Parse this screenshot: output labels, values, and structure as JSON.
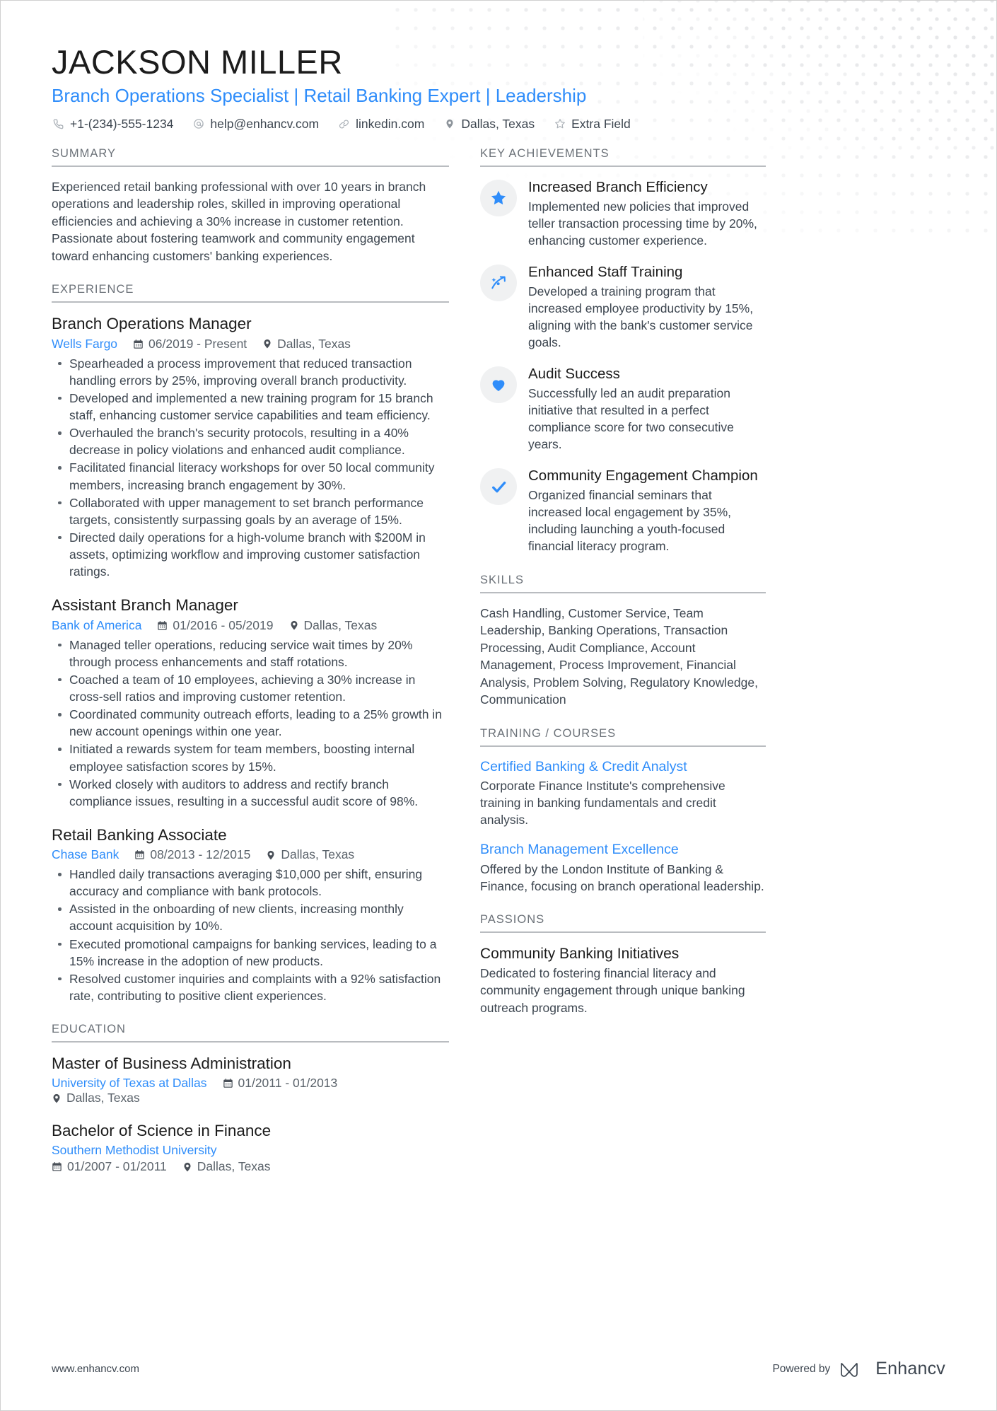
{
  "header": {
    "name": "JACKSON MILLER",
    "headline": "Branch Operations Specialist | Retail Banking Expert | Leadership",
    "contacts": [
      {
        "icon": "phone-icon",
        "text": "+1-(234)-555-1234"
      },
      {
        "icon": "email-icon",
        "text": "help@enhancv.com"
      },
      {
        "icon": "link-icon",
        "text": "linkedin.com"
      },
      {
        "icon": "location-icon",
        "text": "Dallas, Texas"
      },
      {
        "icon": "star-outline-icon",
        "text": "Extra Field"
      }
    ]
  },
  "summary": {
    "section_title": "SUMMARY",
    "text": "Experienced retail banking professional with over 10 years in branch operations and leadership roles, skilled in improving operational efficiencies and achieving a 30% increase in customer retention. Passionate about fostering teamwork and community engagement toward enhancing customers' banking experiences."
  },
  "experience": {
    "section_title": "EXPERIENCE",
    "entries": [
      {
        "title": "Branch Operations Manager",
        "org": "Wells Fargo",
        "dates": "06/2019 - Present",
        "location": "Dallas, Texas",
        "bullets": [
          "Spearheaded a process improvement that reduced transaction handling errors by 25%, improving overall branch productivity.",
          "Developed and implemented a new training program for 15 branch staff, enhancing customer service capabilities and team efficiency.",
          "Overhauled the branch's security protocols, resulting in a 40% decrease in policy violations and enhanced audit compliance.",
          "Facilitated financial literacy workshops for over 50 local community members, increasing branch engagement by 30%.",
          "Collaborated with upper management to set branch performance targets, consistently surpassing goals by an average of 15%.",
          "Directed daily operations for a high-volume branch with $200M in assets, optimizing workflow and improving customer satisfaction ratings."
        ]
      },
      {
        "title": "Assistant Branch Manager",
        "org": "Bank of America",
        "dates": "01/2016 - 05/2019",
        "location": "Dallas, Texas",
        "bullets": [
          "Managed teller operations, reducing service wait times by 20% through process enhancements and staff rotations.",
          "Coached a team of 10 employees, achieving a 30% increase in cross-sell ratios and improving customer retention.",
          "Coordinated community outreach efforts, leading to a 25% growth in new account openings within one year.",
          "Initiated a rewards system for team members, boosting internal employee satisfaction scores by 15%.",
          "Worked closely with auditors to address and rectify branch compliance issues, resulting in a successful audit score of 98%."
        ]
      },
      {
        "title": "Retail Banking Associate",
        "org": "Chase Bank",
        "dates": "08/2013 - 12/2015",
        "location": "Dallas, Texas",
        "bullets": [
          "Handled daily transactions averaging $10,000 per shift, ensuring accuracy and compliance with bank protocols.",
          "Assisted in the onboarding of new clients, increasing monthly account acquisition by 10%.",
          "Executed promotional campaigns for banking services, leading to a 15% increase in the adoption of new products.",
          "Resolved customer inquiries and complaints with a 92% satisfaction rate, contributing to positive client experiences."
        ]
      }
    ]
  },
  "education": {
    "section_title": "EDUCATION",
    "entries": [
      {
        "title": "Master of Business Administration",
        "org": "University of Texas at Dallas",
        "dates": "01/2011 - 01/2013",
        "location": "Dallas, Texas",
        "inline": true
      },
      {
        "title": "Bachelor of Science in Finance",
        "org": "Southern Methodist University",
        "dates": "01/2007 - 01/2011",
        "location": "Dallas, Texas",
        "inline": false
      }
    ]
  },
  "key_achievements": {
    "section_title": "KEY ACHIEVEMENTS",
    "items": [
      {
        "icon": "star-icon",
        "title": "Increased Branch Efficiency",
        "description": "Implemented new policies that improved teller transaction processing time by 20%, enhancing customer experience."
      },
      {
        "icon": "growth-arrow-icon",
        "title": "Enhanced Staff Training",
        "description": "Developed a training program that increased employee productivity by 15%, aligning with the bank's customer service goals."
      },
      {
        "icon": "heart-icon",
        "title": "Audit Success",
        "description": "Successfully led an audit preparation initiative that resulted in a perfect compliance score for two consecutive years."
      },
      {
        "icon": "check-icon",
        "title": "Community Engagement Champion",
        "description": "Organized financial seminars that increased local engagement by 35%, including launching a youth-focused financial literacy program."
      }
    ]
  },
  "skills": {
    "section_title": "SKILLS",
    "text": "Cash Handling, Customer Service, Team Leadership, Banking Operations, Transaction Processing, Audit Compliance, Account Management, Process Improvement, Financial Analysis, Problem Solving, Regulatory Knowledge, Communication"
  },
  "training": {
    "section_title": "TRAINING / COURSES",
    "items": [
      {
        "title": "Certified Banking & Credit Analyst",
        "description": "Corporate Finance Institute's comprehensive training in banking fundamentals and credit analysis."
      },
      {
        "title": "Branch Management Excellence",
        "description": "Offered by the London Institute of Banking & Finance, focusing on branch operational leadership."
      }
    ]
  },
  "passions": {
    "section_title": "PASSIONS",
    "items": [
      {
        "title": "Community Banking Initiatives",
        "description": "Dedicated to fostering financial literacy and community engagement through unique banking outreach programs."
      }
    ]
  },
  "footer": {
    "url": "www.enhancv.com",
    "powered_by": "Powered by",
    "brand": "Enhancv"
  },
  "colors": {
    "accent_blue": "#2f8dfa",
    "heading_dark": "#1c1c1c",
    "body_gray": "#3d4650",
    "muted_gray": "#6b7178",
    "badge_bg": "#f0f1f2"
  }
}
